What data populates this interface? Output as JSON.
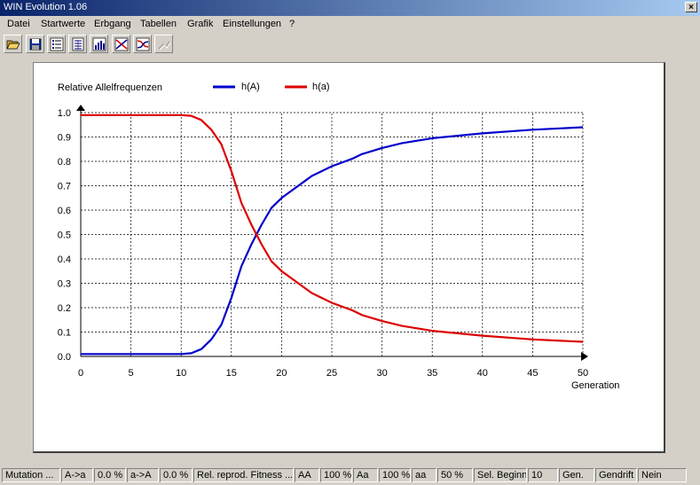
{
  "window": {
    "title": "WIN Evolution 1.06",
    "close": "×"
  },
  "menu": [
    "Datei",
    "Startwerte",
    "Erbgang",
    "Tabellen",
    "Grafik",
    "Einstellungen",
    "?"
  ],
  "toolbar": {
    "buttons": [
      "open-folder-icon",
      "save-disk-icon",
      "list-table-icon",
      "data-table-icon",
      "chart-table-icon",
      "chart-red-lines-icon",
      "chart-two-lines-icon",
      "chart-disabled-icon"
    ]
  },
  "chart_data": {
    "type": "line",
    "title": "Relative Allelfrequenzen",
    "xlabel": "Generation",
    "ylabel": "",
    "xlim": [
      0,
      50
    ],
    "ylim": [
      0,
      1
    ],
    "x_ticks": [
      "0",
      "5",
      "10",
      "15",
      "20",
      "25",
      "30",
      "35",
      "40",
      "45",
      "50"
    ],
    "y_ticks": [
      "0.0",
      "0.1",
      "0.2",
      "0.3",
      "0.4",
      "0.5",
      "0.6",
      "0.7",
      "0.8",
      "0.9",
      "1.0"
    ],
    "grid": true,
    "legend": "top",
    "x": [
      0,
      5,
      10,
      11,
      12,
      13,
      14,
      15,
      16,
      17,
      18,
      19,
      20,
      21,
      22,
      23,
      24,
      25,
      26,
      27,
      28,
      30,
      32,
      35,
      40,
      45,
      50
    ],
    "series": [
      {
        "name": "h(A)",
        "color": "#0000cc",
        "values": [
          0.01,
          0.01,
          0.01,
          0.013,
          0.03,
          0.07,
          0.13,
          0.24,
          0.37,
          0.46,
          0.54,
          0.61,
          0.65,
          0.68,
          0.71,
          0.74,
          0.76,
          0.78,
          0.795,
          0.81,
          0.83,
          0.855,
          0.875,
          0.895,
          0.915,
          0.93,
          0.94
        ]
      },
      {
        "name": "h(a)",
        "color": "#dd0000",
        "values": [
          0.99,
          0.99,
          0.99,
          0.987,
          0.97,
          0.93,
          0.87,
          0.76,
          0.63,
          0.54,
          0.46,
          0.39,
          0.35,
          0.32,
          0.29,
          0.26,
          0.24,
          0.22,
          0.205,
          0.19,
          0.17,
          0.145,
          0.125,
          0.105,
          0.085,
          0.07,
          0.06
        ]
      }
    ]
  },
  "status": {
    "cells": [
      "Mutation ...",
      "A->a",
      "0.0 %",
      "a->A",
      "0.0 %",
      "Rel. reprod. Fitness ...",
      "AA",
      "100 %",
      "Aa",
      "100 %",
      "aa",
      "50 %",
      "Sel. Beginn",
      "10",
      "Gen.",
      "Gendrift",
      "Nein"
    ]
  }
}
